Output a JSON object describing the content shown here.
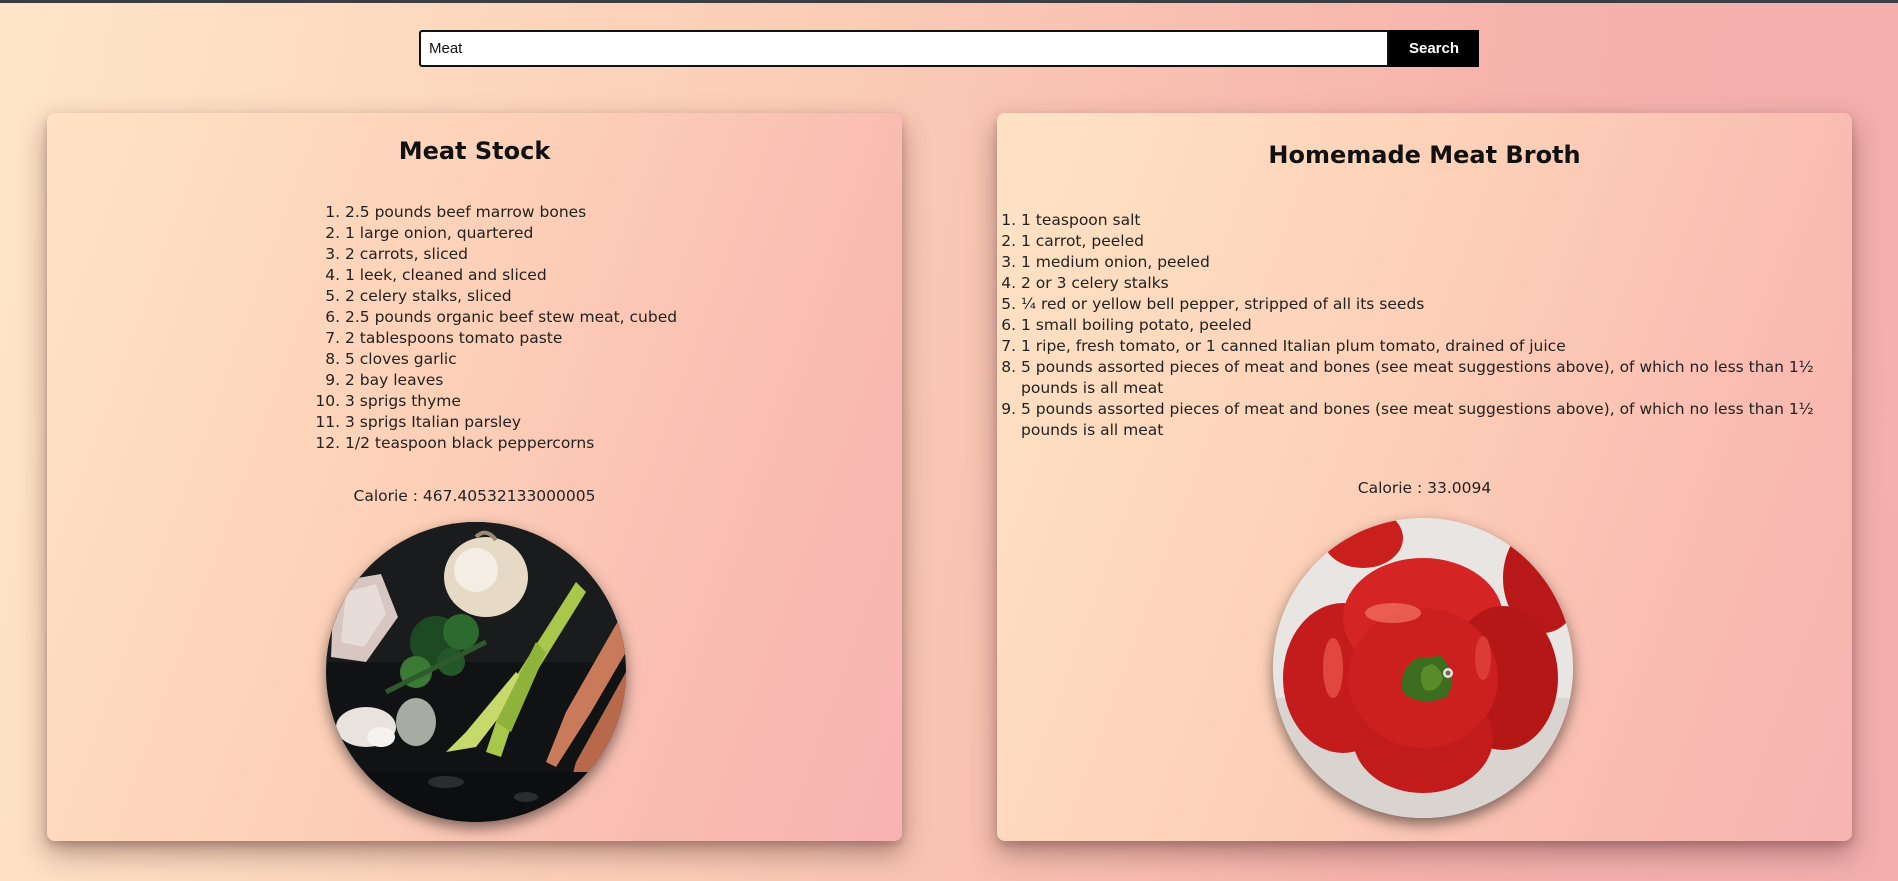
{
  "search": {
    "value": "Meat",
    "button_label": "Search"
  },
  "recipes": [
    {
      "title": "Meat Stock",
      "ingredients": [
        "2.5 pounds beef marrow bones",
        "1 large onion, quartered",
        "2 carrots, sliced",
        "1 leek, cleaned and sliced",
        "2 celery stalks, sliced",
        "2.5 pounds organic beef stew meat, cubed",
        "2 tablespoons tomato paste",
        "5 cloves garlic",
        "2 bay leaves",
        "3 sprigs thyme",
        "3 sprigs Italian parsley",
        "1/2 teaspoon black peppercorns"
      ],
      "calorie": "Calorie : 467.40532133000005",
      "image_icon": "vegetables-photo"
    },
    {
      "title": "Homemade Meat Broth",
      "ingredients": [
        "1 teaspoon salt",
        "1 carrot, peeled",
        "1 medium onion, peeled",
        "2 or 3 celery stalks",
        "¼ red or yellow bell pepper, stripped of all its seeds",
        "1 small boiling potato, peeled",
        "1 ripe, fresh tomato, or 1 canned Italian plum tomato, drained of juice",
        "5 pounds assorted pieces of meat and bones (see meat suggestions above), of which no less than 1½ pounds is all meat",
        "5 pounds assorted pieces of meat and bones (see meat suggestions above), of which no less than 1½ pounds is all meat"
      ],
      "calorie": "Calorie : 33.0094",
      "image_icon": "red-bell-pepper-photo"
    }
  ]
}
